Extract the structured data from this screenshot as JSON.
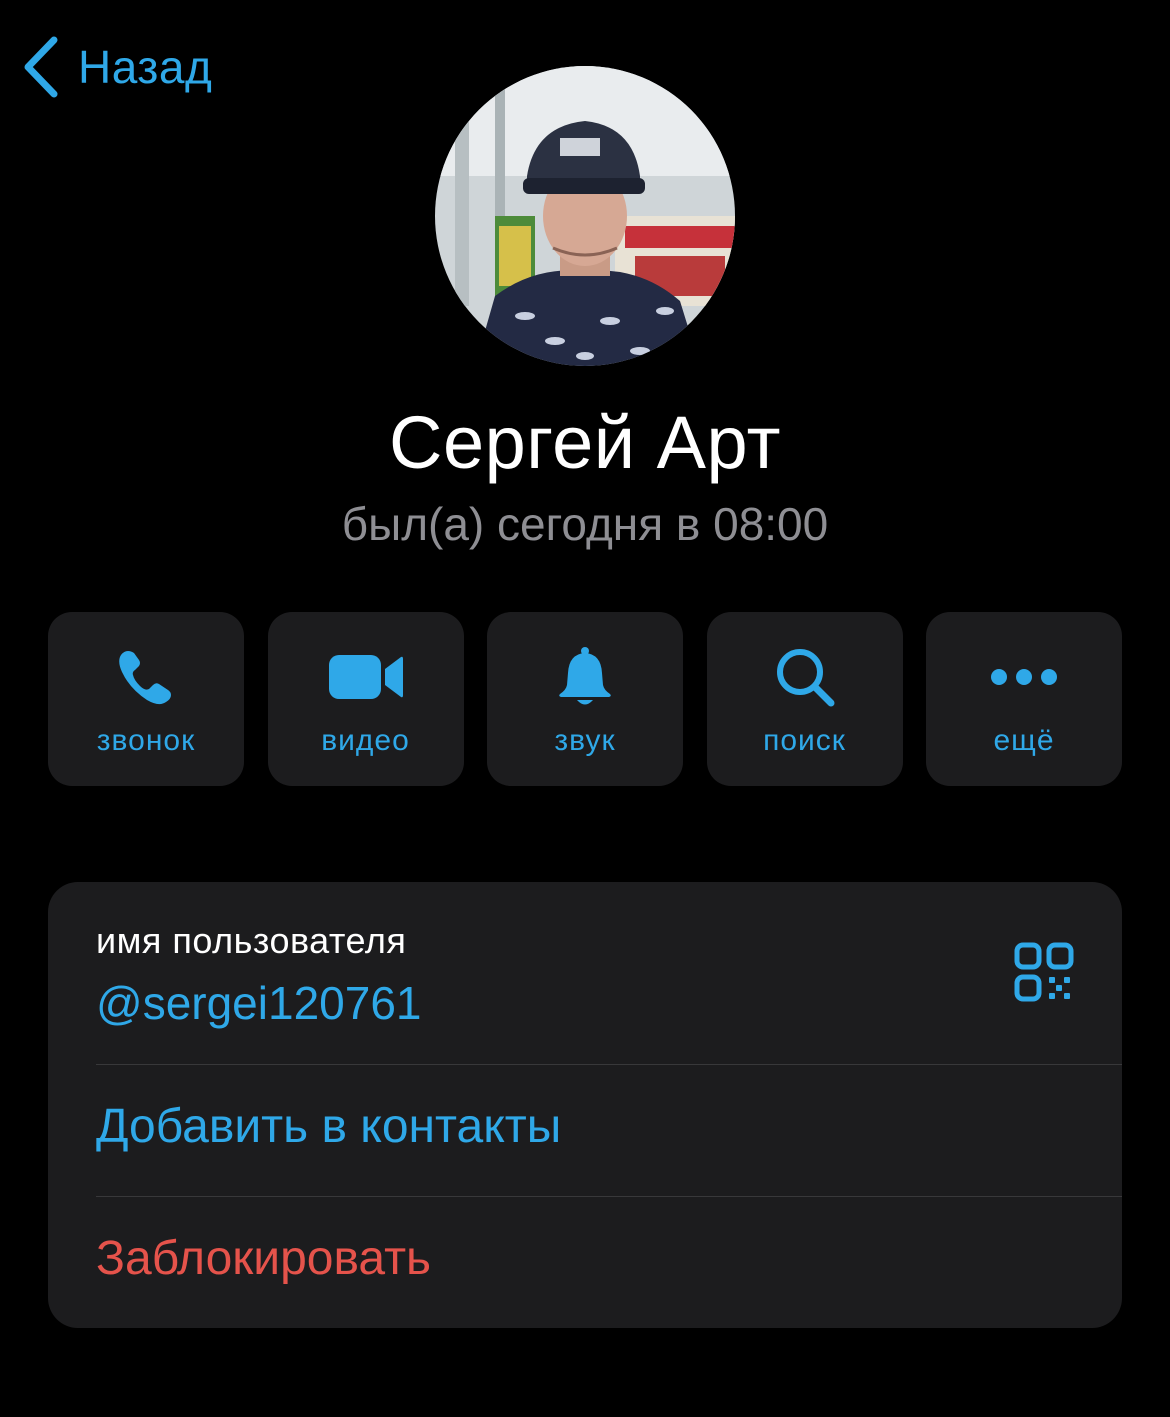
{
  "nav": {
    "back_label": "Назад"
  },
  "profile": {
    "name": "Сергей Арт",
    "status": "был(а) сегодня в 08:00",
    "avatar_alt": "avatar"
  },
  "actions": [
    {
      "label": "звонок",
      "icon": "phone-icon"
    },
    {
      "label": "видео",
      "icon": "video-camera-icon"
    },
    {
      "label": "звук",
      "icon": "bell-icon"
    },
    {
      "label": "поиск",
      "icon": "search-icon"
    },
    {
      "label": "ещё",
      "icon": "more-dots-icon"
    }
  ],
  "info": {
    "username_caption": "имя пользователя",
    "username": "@sergei120761",
    "add_contact": "Добавить в контакты",
    "block": "Заблокировать"
  },
  "colors": {
    "background": "#000000",
    "surface": "#1c1c1e",
    "accent": "#2fa8e8",
    "secondary_text": "#8e8e93",
    "destructive": "#e5534b",
    "separator": "#38383a"
  }
}
